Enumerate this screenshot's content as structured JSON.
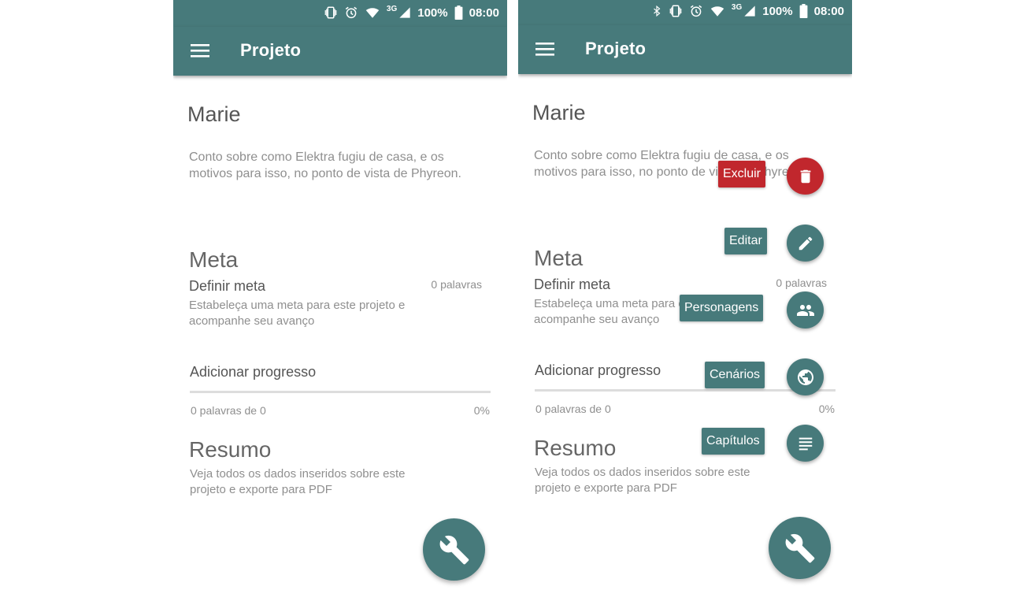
{
  "status": {
    "battery": "100%",
    "time": "08:00",
    "network": "3G"
  },
  "appbar": {
    "title": "Projeto"
  },
  "project": {
    "name": "Marie",
    "description": "Conto sobre como Elektra fugiu de casa, e os motivos para isso, no ponto de vista de Phyreon."
  },
  "meta": {
    "title": "Meta",
    "subtitle": "Definir meta",
    "word_count": "0 palavras",
    "description": "Estabeleça uma meta para este projeto e acompanhe seu avanço"
  },
  "progress": {
    "field_label": "Adicionar progresso",
    "words_text": "0 palavras de 0",
    "percent": "0%"
  },
  "resumo": {
    "title": "Resumo",
    "description": "Veja todos os dados inseridos sobre este projeto e exporte para PDF"
  },
  "fab_menu": {
    "items": [
      {
        "label": "Excluir",
        "icon": "delete-icon",
        "color": "#c1272d"
      },
      {
        "label": "Editar",
        "icon": "edit-icon",
        "color": "#477a7b"
      },
      {
        "label": "Personagens",
        "icon": "people-icon",
        "color": "#477a7b"
      },
      {
        "label": "Cenários",
        "icon": "globe-icon",
        "color": "#477a7b"
      },
      {
        "label": "Capítulos",
        "icon": "chapters-icon",
        "color": "#477a7b"
      }
    ]
  },
  "colors": {
    "primary": "#477a7b",
    "danger": "#c1272d"
  }
}
